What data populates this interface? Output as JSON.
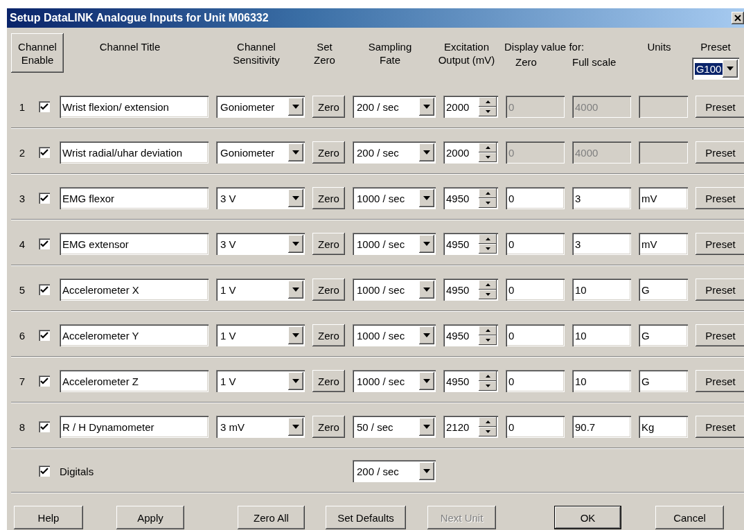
{
  "window": {
    "title": "Setup DataLINK Analogue Inputs for Unit M06332"
  },
  "header": {
    "enable_button": "Channel\nEnable",
    "title": "Channel Title",
    "sensitivity": "Channel\nSensitivity",
    "set_zero": "Set\nZero",
    "sampling": "Sampling\nFate",
    "excitation": "Excitation\nOutput (mV)",
    "display_value": "Display value for:",
    "zero": "Zero",
    "full_scale": "Full scale",
    "units": "Units",
    "preset": "Preset",
    "preset_select": {
      "value": "G100",
      "focused": true
    }
  },
  "channels": [
    {
      "number": "1",
      "enabled": true,
      "title": "Wrist flexion/ extension",
      "sensitivity": "Goniometer",
      "zero_button": "Zero",
      "sampling": "200 / sec",
      "excitation": "2000",
      "display_enabled": false,
      "zero": "0",
      "full_scale": "4000",
      "preset_button": "Preset"
    },
    {
      "number": "2",
      "enabled": true,
      "title": "Wrist radial/uhar deviation",
      "sensitivity": "Goniometer",
      "zero_button": "Zero",
      "sampling": "200 / sec",
      "excitation": "2000",
      "display_enabled": false,
      "zero": "0",
      "full_scale": "4000",
      "preset_button": "Preset"
    },
    {
      "number": "3",
      "enabled": true,
      "title": "EMG flexor",
      "sensitivity": "3 V",
      "zero_button": "Zero",
      "sampling": "1000 / sec",
      "excitation": "4950",
      "display_enabled": true,
      "zero": "0",
      "full_scale": "3",
      "units": "mV",
      "preset_button": "Preset"
    },
    {
      "number": "4",
      "enabled": true,
      "title": "EMG extensor",
      "sensitivity": "3 V",
      "zero_button": "Zero",
      "sampling": "1000 / sec",
      "excitation": "4950",
      "display_enabled": true,
      "zero": "0",
      "full_scale": "3",
      "units": "mV",
      "preset_button": "Preset"
    },
    {
      "number": "5",
      "enabled": true,
      "title": "Accelerometer X",
      "sensitivity": "1 V",
      "zero_button": "Zero",
      "sampling": "1000 / sec",
      "excitation": "4950",
      "display_enabled": true,
      "zero": "0",
      "full_scale": "10",
      "units": "G",
      "preset_button": "Preset"
    },
    {
      "number": "6",
      "enabled": true,
      "title": "Accelerometer Y",
      "sensitivity": "1 V",
      "zero_button": "Zero",
      "sampling": "1000 / sec",
      "excitation": "4950",
      "display_enabled": true,
      "zero": "0",
      "full_scale": "10",
      "units": "G",
      "preset_button": "Preset"
    },
    {
      "number": "7",
      "enabled": true,
      "title": "Accelerometer Z",
      "sensitivity": "1 V",
      "zero_button": "Zero",
      "sampling": "1000 / sec",
      "excitation": "4950",
      "display_enabled": true,
      "zero": "0",
      "full_scale": "10",
      "units": "G",
      "preset_button": "Preset"
    },
    {
      "number": "8",
      "enabled": true,
      "title": "R / H Dynamometer",
      "sensitivity": "3 mV",
      "zero_button": "Zero",
      "sampling": "50 / sec",
      "excitation": "2120",
      "display_enabled": true,
      "zero": "0",
      "full_scale": "90.7",
      "units": "Kg",
      "preset_button": "Preset"
    }
  ],
  "digitals": {
    "label": "Digitals",
    "checked": true,
    "sampling": "200 / sec"
  },
  "buttons": [
    {
      "label": "Help",
      "disabled": false,
      "default": false
    },
    {
      "label": "Apply",
      "disabled": false,
      "default": false
    },
    {
      "label": "Zero All",
      "disabled": false,
      "default": false
    },
    {
      "label": "Set Defaults",
      "disabled": false,
      "default": false
    },
    {
      "label": "Next Unit",
      "disabled": true,
      "default": false
    },
    {
      "label": "OK",
      "disabled": false,
      "default": true
    },
    {
      "label": "Cancel",
      "disabled": false,
      "default": false
    }
  ]
}
